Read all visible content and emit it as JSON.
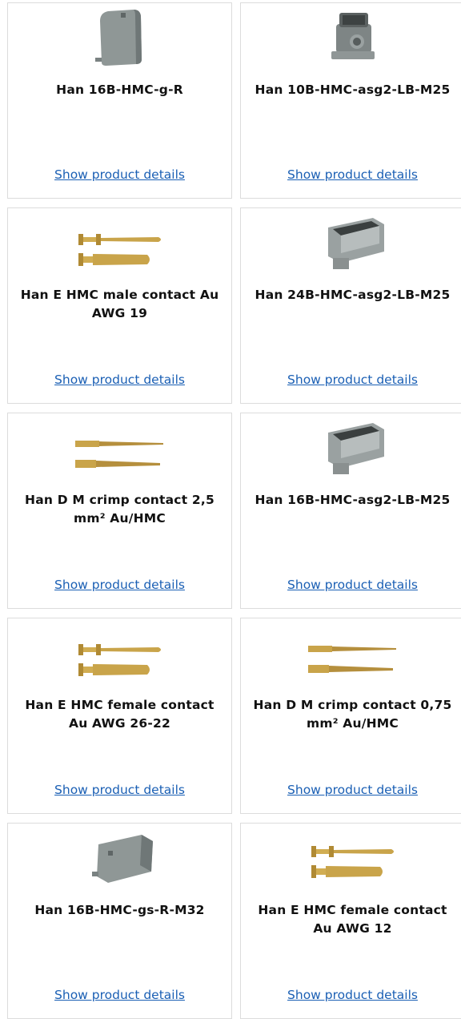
{
  "products": [
    {
      "name": "Han 16B-HMC-g-R",
      "link": "Show product details",
      "icon": "hood-icon"
    },
    {
      "name": "Han 10B-HMC-asg2-LB-M25",
      "link": "Show product details",
      "icon": "housing-icon"
    },
    {
      "name": "Han E HMC male contact Au AWG 19",
      "link": "Show product details",
      "icon": "contact-pins-icon"
    },
    {
      "name": "Han 24B-HMC-asg2-LB-M25",
      "link": "Show product details",
      "icon": "housing-icon"
    },
    {
      "name": "Han D M crimp contact 2,5 mm² Au/HMC",
      "link": "Show product details",
      "icon": "contact-pins-icon"
    },
    {
      "name": "Han 16B-HMC-asg2-LB-M25",
      "link": "Show product details",
      "icon": "housing-icon"
    },
    {
      "name": "Han E HMC female contact Au AWG 26-22",
      "link": "Show product details",
      "icon": "contact-pins-icon"
    },
    {
      "name": "Han D M crimp contact 0,75 mm² Au/HMC",
      "link": "Show product details",
      "icon": "contact-pins-icon"
    },
    {
      "name": "Han 16B-HMC-gs-R-M32",
      "link": "Show product details",
      "icon": "hood-icon"
    },
    {
      "name": "Han E HMC female contact Au AWG 12",
      "link": "Show product details",
      "icon": "contact-pins-icon"
    }
  ],
  "colors": {
    "link": "#1a5fb4",
    "border": "#dcdcdc",
    "metal": "#8d9494",
    "gold": "#c9a44a"
  }
}
